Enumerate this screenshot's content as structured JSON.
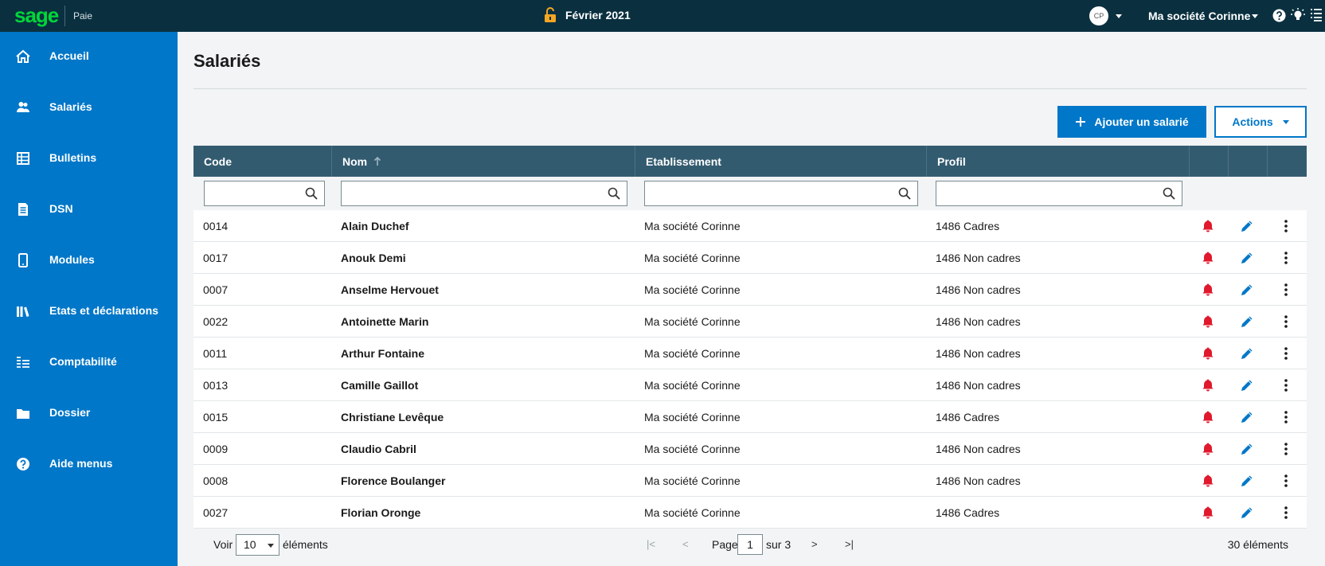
{
  "topbar": {
    "logo": "sage",
    "app_name": "Paie",
    "period": "Février 2021",
    "avatar_initials": "CP",
    "company": "Ma société Corinne"
  },
  "sidebar": {
    "items": [
      {
        "label": "Accueil",
        "icon": "home-icon"
      },
      {
        "label": "Salariés",
        "icon": "users-icon"
      },
      {
        "label": "Bulletins",
        "icon": "table-icon"
      },
      {
        "label": "DSN",
        "icon": "document-icon"
      },
      {
        "label": "Modules",
        "icon": "tablet-icon"
      },
      {
        "label": "Etats et déclarations",
        "icon": "library-icon"
      },
      {
        "label": "Comptabilité",
        "icon": "ledger-icon"
      },
      {
        "label": "Dossier",
        "icon": "folder-icon"
      },
      {
        "label": "Aide menus",
        "icon": "help-icon"
      }
    ]
  },
  "main": {
    "title": "Salariés",
    "add_button": "Ajouter un salarié",
    "actions_button": "Actions"
  },
  "table": {
    "columns": [
      "Code",
      "Nom",
      "Etablissement",
      "Profil"
    ],
    "rows": [
      {
        "code": "0014",
        "nom": "Alain Duchef",
        "etab": "Ma société Corinne",
        "profil": "1486 Cadres"
      },
      {
        "code": "0017",
        "nom": "Anouk Demi",
        "etab": "Ma société Corinne",
        "profil": "1486 Non cadres"
      },
      {
        "code": "0007",
        "nom": "Anselme Hervouet",
        "etab": "Ma société Corinne",
        "profil": "1486 Non cadres"
      },
      {
        "code": "0022",
        "nom": "Antoinette Marin",
        "etab": "Ma société Corinne",
        "profil": "1486 Non cadres"
      },
      {
        "code": "0011",
        "nom": "Arthur Fontaine",
        "etab": "Ma société Corinne",
        "profil": "1486 Non cadres"
      },
      {
        "code": "0013",
        "nom": "Camille Gaillot",
        "etab": "Ma société Corinne",
        "profil": "1486 Non cadres"
      },
      {
        "code": "0015",
        "nom": "Christiane Levêque",
        "etab": "Ma société Corinne",
        "profil": "1486 Cadres"
      },
      {
        "code": "0009",
        "nom": "Claudio Cabril",
        "etab": "Ma société Corinne",
        "profil": "1486 Non cadres"
      },
      {
        "code": "0008",
        "nom": "Florence Boulanger",
        "etab": "Ma société Corinne",
        "profil": "1486 Non cadres"
      },
      {
        "code": "0027",
        "nom": "Florian Oronge",
        "etab": "Ma société Corinne",
        "profil": "1486 Cadres"
      }
    ]
  },
  "pager": {
    "voir": "Voir",
    "page_size": "10",
    "elements": "éléments",
    "first": "|<",
    "prev": "<",
    "page_label": "Page",
    "page": "1",
    "of": "sur 3",
    "next": ">",
    "last": ">|",
    "total": "30 éléments"
  },
  "colors": {
    "topbar": "#0a3040",
    "sidebar": "#0077c8",
    "table_header": "#335b70",
    "bell": "#e0192d",
    "pencil": "#0077c8",
    "brand_green": "#00d639"
  }
}
